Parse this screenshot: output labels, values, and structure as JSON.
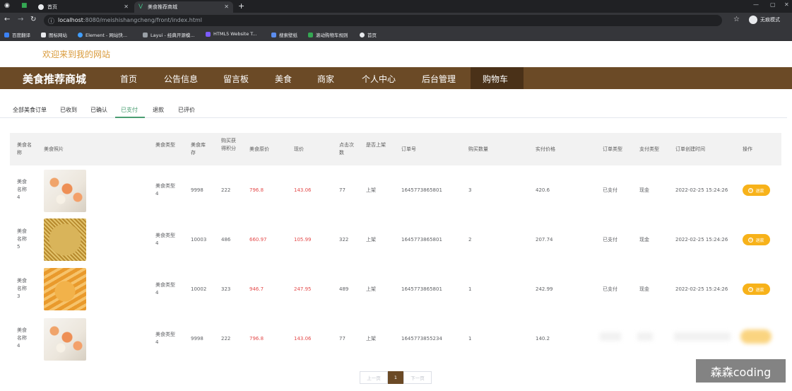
{
  "browser": {
    "tabs": [
      {
        "label": "首页",
        "active": false
      },
      {
        "label": "美食推荐商城",
        "active": true
      }
    ],
    "url_host": "localhost",
    "url_rest": ":8080/meishishangcheng/front/index.html",
    "incognito_label": "无痕模式",
    "bookmarks": [
      "百度翻译",
      "图标网站",
      "Element - 网站快...",
      "Layui - 经典开源模...",
      "HTML5 Website T...",
      "搜索壁纸",
      "滚动购物车规则",
      "首页"
    ]
  },
  "site": {
    "welcome": "欢迎来到我的网站",
    "brand": "美食推荐商城",
    "nav": [
      "首页",
      "公告信息",
      "留言板",
      "美食",
      "商家",
      "个人中心",
      "后台管理",
      "购物车"
    ],
    "nav_active": "购物车"
  },
  "order_tabs": {
    "items": [
      "全部美食订单",
      "已收到",
      "已确认",
      "已支付",
      "退款",
      "已评价"
    ],
    "active": "已支付"
  },
  "table": {
    "headers": {
      "name": "美食名称",
      "photo": "美食照片",
      "type": "美食类型",
      "stock": "美食库存",
      "points": "购买获得积分",
      "orig_price": "美食原价",
      "price": "现价",
      "clicks": "点击次数",
      "listed": "是否上架",
      "order_no": "订单号",
      "qty": "购买数量",
      "paid": "实付价格",
      "order_type": "订单类型",
      "pay_type": "支付类型",
      "created": "订单创建时间",
      "action": "操作"
    },
    "rows": [
      {
        "name": "美食名称4",
        "photo": "sushi",
        "type": "美食类型4",
        "stock": "9998",
        "points": "222",
        "orig_price": "796.8",
        "price": "143.06",
        "clicks": "77",
        "listed": "上架",
        "order_no": "1645773865801",
        "qty": "3",
        "paid": "420.6",
        "order_type": "已支付",
        "pay_type": "现金",
        "created": "2022-02-25 15:24:26",
        "action": "退款"
      },
      {
        "name": "美食名称5",
        "photo": "pancake",
        "type": "美食类型4",
        "stock": "10003",
        "points": "486",
        "orig_price": "660.97",
        "price": "105.99",
        "clicks": "322",
        "listed": "上架",
        "order_no": "1645773865801",
        "qty": "2",
        "paid": "207.74",
        "order_type": "已支付",
        "pay_type": "现金",
        "created": "2022-02-25 15:24:26",
        "action": "退款"
      },
      {
        "name": "美食名称3",
        "photo": "churro",
        "type": "美食类型4",
        "stock": "10002",
        "points": "323",
        "orig_price": "946.7",
        "price": "247.95",
        "clicks": "489",
        "listed": "上架",
        "order_no": "1645773865801",
        "qty": "1",
        "paid": "242.99",
        "order_type": "已支付",
        "pay_type": "现金",
        "created": "2022-02-25 15:24:26",
        "action": "退款"
      },
      {
        "name": "美食名称4",
        "photo": "sushi",
        "type": "美食类型4",
        "stock": "9998",
        "points": "222",
        "orig_price": "796.8",
        "price": "143.06",
        "clicks": "77",
        "listed": "上架",
        "order_no": "1645773855234",
        "qty": "1",
        "paid": "140.2",
        "order_type": "",
        "pay_type": "",
        "created": "",
        "action": ""
      }
    ]
  },
  "pagination": {
    "prev": "上一页",
    "page": "1",
    "next": "下一页"
  },
  "watermark": "森森coding",
  "colors": {
    "nav_bg": "#6b4a26",
    "accent_gold": "#f7b21a",
    "price_red": "#e44b4b",
    "tab_green": "#4a9e72"
  }
}
